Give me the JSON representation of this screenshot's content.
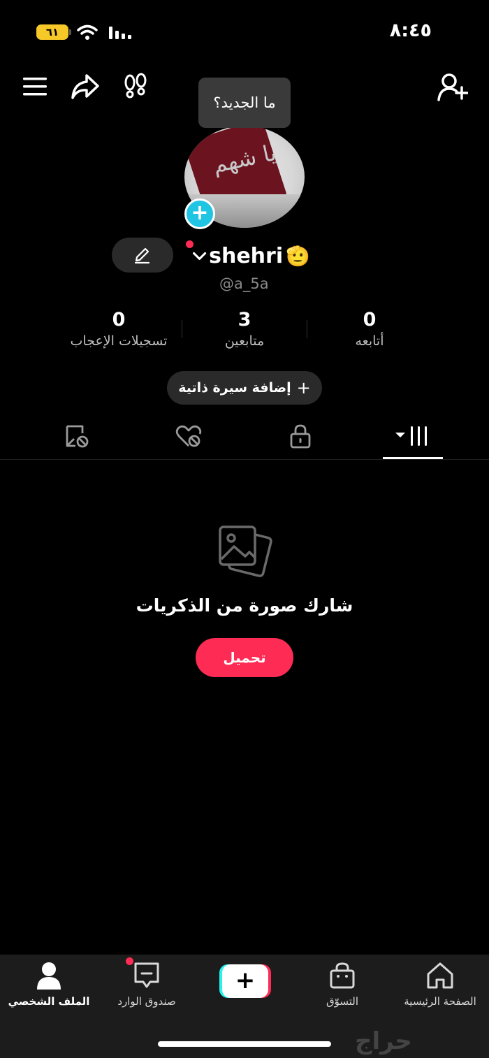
{
  "status_bar": {
    "time": "٨:٤٥",
    "battery": "٦١"
  },
  "header": {
    "tooltip": "ما الجديد؟"
  },
  "profile": {
    "avatar_flag_text": "يا شهم",
    "name": "shehri",
    "name_emoji": "🫡",
    "username": "@a_5a"
  },
  "stats": [
    {
      "value": "0",
      "label": "أتابعه"
    },
    {
      "value": "3",
      "label": "متابعين"
    },
    {
      "value": "0",
      "label": "تسجيلات الإعجاب"
    }
  ],
  "bio_button": {
    "plus": "+",
    "label": "إضافة سيرة ذاتية"
  },
  "tabs": [
    "videos-tab",
    "private-tab",
    "liked-tab",
    "reposts-tab"
  ],
  "empty_state": {
    "text": "شارك صورة من الذكريات",
    "button": "تحميل"
  },
  "bottom_nav": [
    {
      "label": "الصفحة الرئيسية",
      "icon": "home-icon"
    },
    {
      "label": "التسوّق",
      "icon": "shopping-bag-icon"
    },
    {
      "label": "+",
      "icon": "create-icon"
    },
    {
      "label": "صندوق الوارد",
      "icon": "inbox-icon"
    },
    {
      "label": "الملف الشخصي",
      "icon": "profile-icon"
    }
  ],
  "watermark": "حراج",
  "colors": {
    "accent": "#fe2c55",
    "cyan": "#25f4ee",
    "avatar_add": "#20c5e3",
    "battery": "#f6c828"
  }
}
